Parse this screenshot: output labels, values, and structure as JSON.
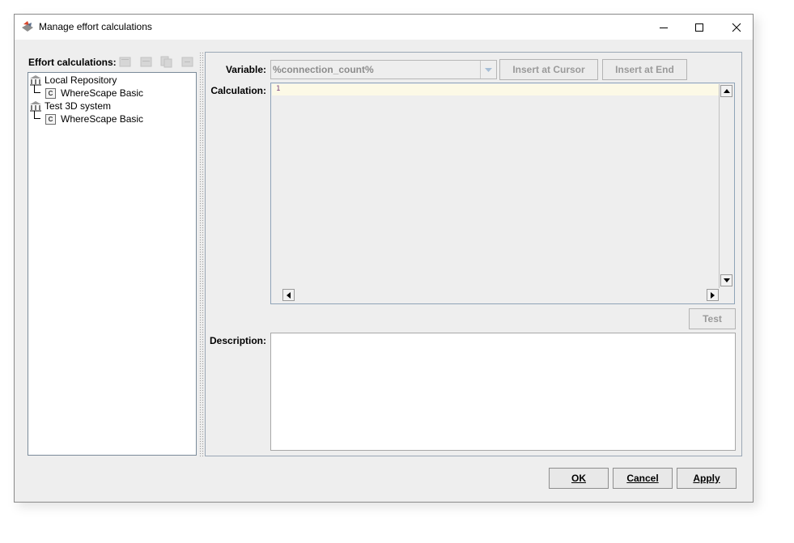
{
  "window": {
    "title": "Manage effort calculations",
    "app_icon": "wherescape-icon",
    "controls": [
      "minimize-icon",
      "maximize-icon",
      "close-icon"
    ]
  },
  "left": {
    "label": "Effort calculations:",
    "toolbar_icons": [
      "new-icon",
      "edit-icon",
      "copy-icon",
      "delete-icon"
    ],
    "tree": [
      {
        "label": "Local Repository",
        "icon": "repository-icon",
        "children": [
          {
            "label": "WhereScape Basic",
            "icon": "calculation-icon",
            "glyph": "C"
          }
        ]
      },
      {
        "label": "Test 3D system",
        "icon": "repository-icon",
        "children": [
          {
            "label": "WhereScape Basic",
            "icon": "calculation-icon",
            "glyph": "C"
          }
        ]
      }
    ]
  },
  "right": {
    "variable_label": "Variable:",
    "variable_value": "%connection_count%",
    "insert_cursor_label": "Insert at Cursor",
    "insert_end_label": "Insert at End",
    "calculation_label": "Calculation:",
    "calculation_line_number": "1",
    "test_label": "Test",
    "description_label": "Description:"
  },
  "buttons": {
    "ok": "OK",
    "cancel": "Cancel",
    "apply": "Apply"
  },
  "colors": {
    "window_bg": "#eeeeee",
    "current_line": "#fcf9e6",
    "disabled_text": "#9a9a9a"
  }
}
